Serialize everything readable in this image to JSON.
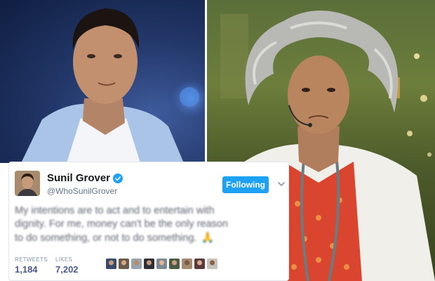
{
  "tweet": {
    "display_name": "Sunil Grover",
    "handle": "@WhoSunilGrover",
    "verified": true,
    "follow_label": "Following",
    "text_lines": [
      "My intentions are to act and to entertain with",
      "dignity. For me, money can't be the only reason",
      "to do something, or not to do something."
    ],
    "emoji": "🙏",
    "stats": {
      "retweets_label": "RETWEETS",
      "retweets_value": "1,184",
      "likes_label": "LIKES",
      "likes_value": "7,202"
    },
    "liker_avatar_count": 9
  },
  "icons": {
    "verified": "verified-badge-icon",
    "caret": "chevron-down-icon"
  },
  "colors": {
    "twitter_blue": "#1da1f2",
    "stat_value": "#4a5b89",
    "name_text": "#14171a",
    "muted_text": "#657786"
  }
}
